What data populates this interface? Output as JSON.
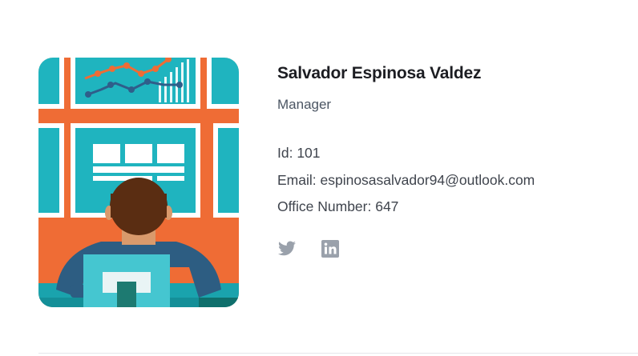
{
  "profile": {
    "name": "Salvador Espinosa Valdez",
    "role": "Manager",
    "id_line": "Id: 101",
    "email_line": "Email: espinosasalvador94@outlook.com",
    "office_line": "Office Number: 647"
  },
  "social": {
    "twitter_icon": "twitter-icon",
    "linkedin_icon": "linkedin-icon"
  },
  "colors": {
    "illustration_teal": "#1fb4bf",
    "illustration_orange": "#ef6c35",
    "icon_gray": "#9aa1ab",
    "name_text": "#1c1d22",
    "body_text": "#3f444d"
  }
}
